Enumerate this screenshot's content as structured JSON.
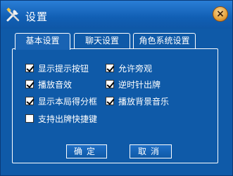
{
  "window": {
    "title": "设置",
    "close_symbol": "×"
  },
  "tabs": [
    {
      "label": "基本设置",
      "active": true
    },
    {
      "label": "聊天设置",
      "active": false
    },
    {
      "label": "角色系统设置",
      "active": false
    }
  ],
  "options": {
    "show_hint_button": {
      "label": "显示提示按钮",
      "checked": true
    },
    "allow_spectate": {
      "label": "允许旁观",
      "checked": true
    },
    "play_sound": {
      "label": "播放音效",
      "checked": true
    },
    "counterclockwise": {
      "label": "逆时针出牌",
      "checked": true
    },
    "show_score_box": {
      "label": "显示本局得分框",
      "checked": true
    },
    "play_bgm": {
      "label": "播放背景音乐",
      "checked": true
    },
    "hotkeys": {
      "label": "支持出牌快捷键",
      "checked": false
    }
  },
  "buttons": {
    "ok": "确定",
    "cancel": "取消"
  },
  "icons": {
    "title": "tools-icon",
    "close": "close-icon"
  },
  "colors": {
    "background": "#0f5aa8",
    "titlebar": "#115fb4",
    "close_button": "#e5a23a",
    "text": "#ffffff"
  }
}
